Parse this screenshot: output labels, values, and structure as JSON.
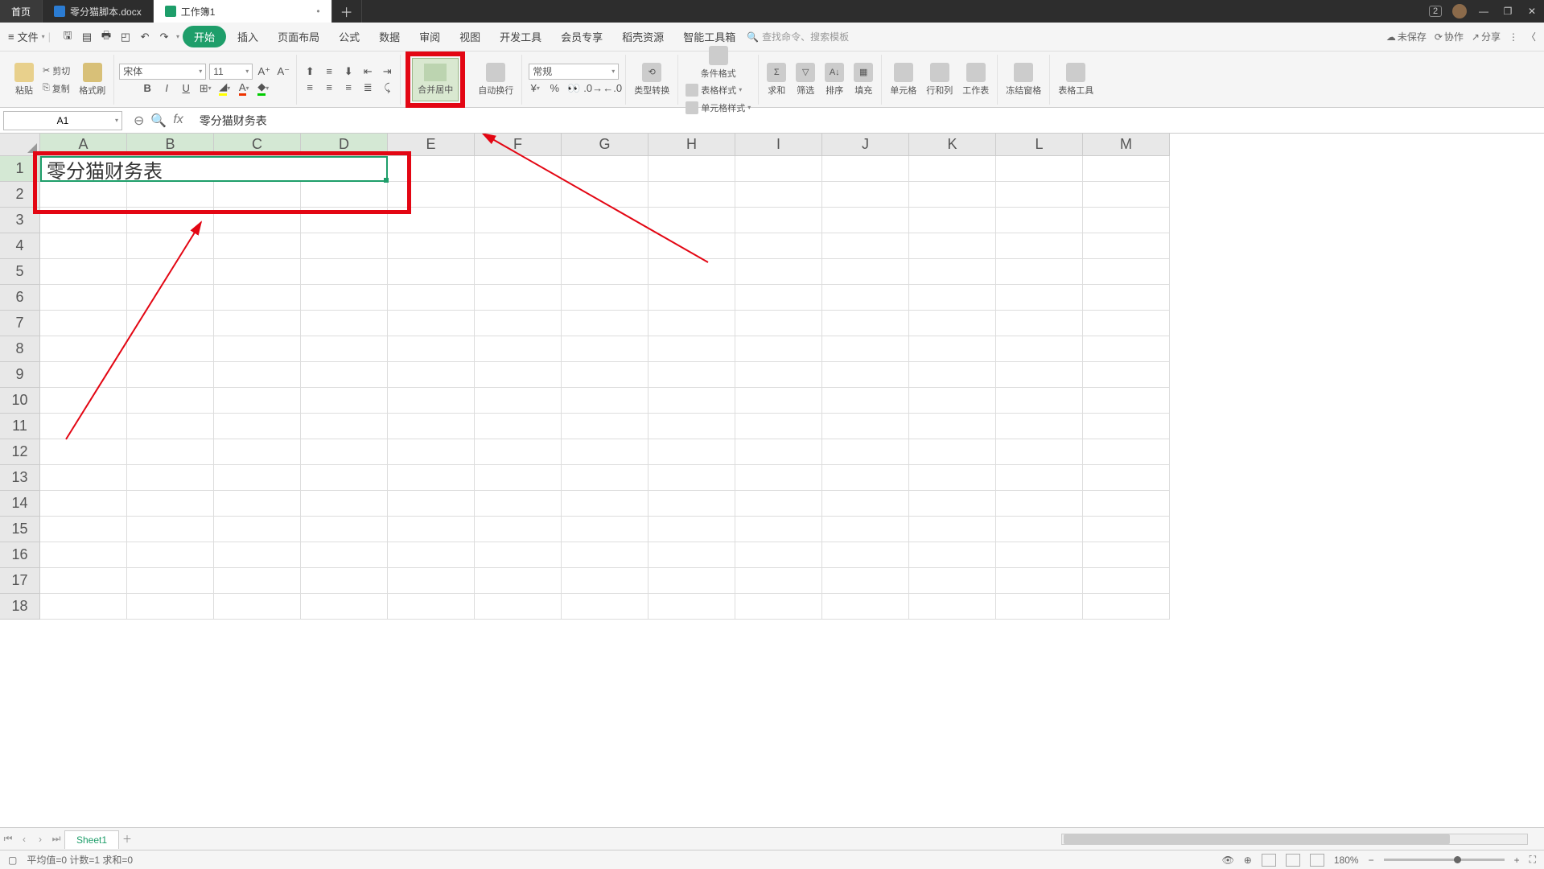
{
  "titlebar": {
    "home": "首页",
    "doc_tab": "零分猫脚本.docx",
    "sheet_tab": "工作簿1",
    "mod_indicator": "•",
    "notif_badge": "2"
  },
  "menubar": {
    "file": "文件",
    "tabs": [
      "开始",
      "插入",
      "页面布局",
      "公式",
      "数据",
      "审阅",
      "视图",
      "开发工具",
      "会员专享",
      "稻壳资源",
      "智能工具箱"
    ],
    "search_placeholder": "查找命令、搜索模板",
    "unsaved": "未保存",
    "coop": "协作",
    "share": "分享"
  },
  "ribbon": {
    "paste": "粘贴",
    "cut": "剪切",
    "copy": "复制",
    "fmtbrush": "格式刷",
    "font_name": "宋体",
    "font_size": "11",
    "merge": "合并居中",
    "wrap": "自动换行",
    "num_fmt": "常规",
    "typeconv": "类型转换",
    "condfmt": "条件格式",
    "tablestyle": "表格样式",
    "cellstyle": "单元格样式",
    "sum": "求和",
    "filter": "筛选",
    "sort": "排序",
    "fill": "填充",
    "cells": "单元格",
    "rowcol": "行和列",
    "worksheet": "工作表",
    "freeze": "冻结窗格",
    "tabletools": "表格工具"
  },
  "fxbar": {
    "cellref": "A1",
    "formula": "零分猫财务表"
  },
  "grid": {
    "cols": [
      "A",
      "B",
      "C",
      "D",
      "E",
      "F",
      "G",
      "H",
      "I",
      "J",
      "K",
      "L",
      "M"
    ],
    "rows": [
      "1",
      "2",
      "3",
      "4",
      "5",
      "6",
      "7",
      "8",
      "9",
      "10",
      "11",
      "12",
      "13",
      "14",
      "15",
      "16",
      "17",
      "18"
    ],
    "merged_cell": "零分猫财务表"
  },
  "sheettabs": {
    "sheet1": "Sheet1"
  },
  "statusbar": {
    "stats": "平均值=0  计数=1  求和=0",
    "zoom": "180%"
  }
}
